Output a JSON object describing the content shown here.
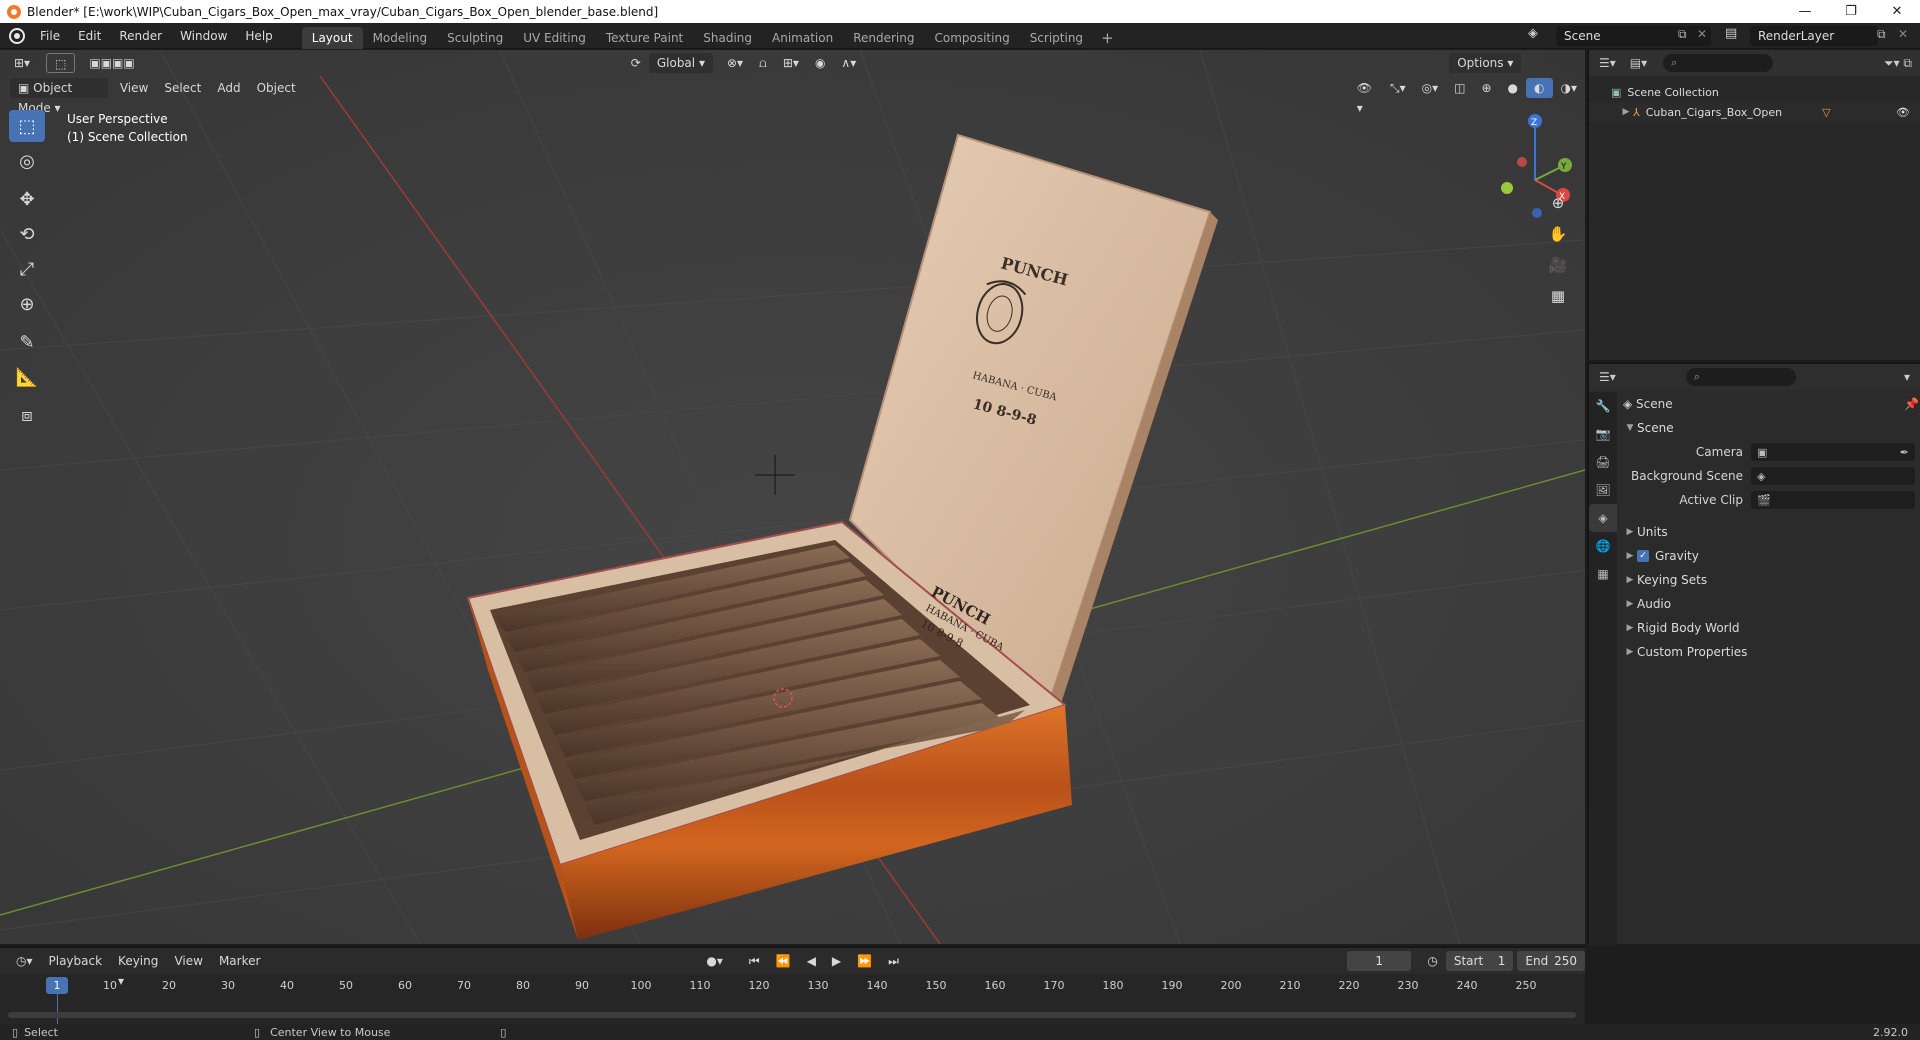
{
  "window": {
    "title": "Blender* [E:\\work\\WIP\\Cuban_Cigars_Box_Open_max_vray/Cuban_Cigars_Box_Open_blender_base.blend]",
    "minimize": "—",
    "maximize": "❐",
    "close": "✕"
  },
  "menu": {
    "items": [
      "File",
      "Edit",
      "Render",
      "Window",
      "Help"
    ],
    "workspaces": [
      "Layout",
      "Modeling",
      "Sculpting",
      "UV Editing",
      "Texture Paint",
      "Shading",
      "Animation",
      "Rendering",
      "Compositing",
      "Scripting"
    ],
    "active_workspace": "Layout",
    "add_tab": "+",
    "scene": "Scene",
    "view_layer": "RenderLayer"
  },
  "viewport": {
    "mode": "Object Mode",
    "menus": [
      "View",
      "Select",
      "Add",
      "Object"
    ],
    "transform_orientation": "Global",
    "options_label": "Options",
    "overlay_line1": "User Perspective",
    "overlay_line2": "(1) Scene Collection",
    "gizmo": {
      "x": "X",
      "y": "Y",
      "z": "Z"
    }
  },
  "artwork": {
    "lid_brand": "PUNCH",
    "lid_origin": "HABANA · CUBA",
    "lid_code": "10 8-9-8",
    "side_brand": "PUNCH",
    "side_origin": "HABANA · CUBA",
    "side_code": "10 8-9-8"
  },
  "outliner": {
    "root": "Scene Collection",
    "object": "Cuban_Cigars_Box_Open",
    "search_placeholder": "⌕"
  },
  "properties": {
    "context": "Scene",
    "section": "Scene",
    "camera_label": "Camera",
    "background_scene_label": "Background Scene",
    "active_clip_label": "Active Clip",
    "panels": [
      "Units",
      "Gravity",
      "Keying Sets",
      "Audio",
      "Rigid Body World",
      "Custom Properties"
    ],
    "gravity_checked": true
  },
  "timeline": {
    "menus": [
      "Playback",
      "Keying",
      "View",
      "Marker"
    ],
    "current_frame": "1",
    "start_label": "Start",
    "start_value": "1",
    "end_label": "End",
    "end_value": "250",
    "ticks": [
      "10",
      "20",
      "30",
      "40",
      "50",
      "60",
      "70",
      "80",
      "90",
      "100",
      "110",
      "120",
      "130",
      "140",
      "150",
      "160",
      "170",
      "180",
      "190",
      "200",
      "210",
      "220",
      "230",
      "240",
      "250"
    ],
    "playhead": "1"
  },
  "status": {
    "left": "Select",
    "middle": "Center View to Mouse",
    "version": "2.92.0"
  }
}
